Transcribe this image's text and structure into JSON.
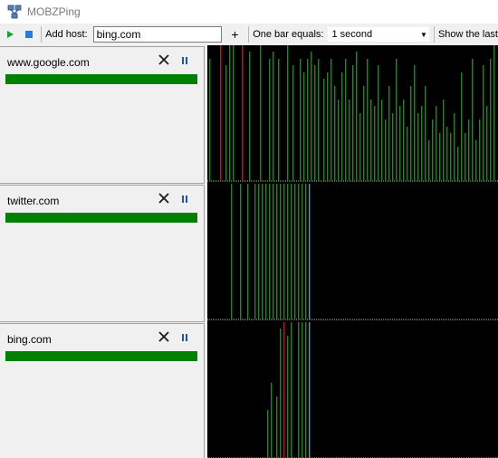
{
  "app": {
    "title": "MOBZPing"
  },
  "toolbar": {
    "add_host_label": "Add host:",
    "host_value": "bing.com",
    "add_button": "+",
    "bar_label": "One bar equals:",
    "bar_value": "1 second",
    "show_last_label": "Show the last"
  },
  "colors": {
    "ok_bar": "#00a000",
    "lost_bar": "#ff0000",
    "marker_bar": "#3fa0d0",
    "status_ok": "#008000",
    "baseline": "#c8c850"
  },
  "hosts": [
    {
      "name": "www.google.com",
      "pings": [
        0,
        1,
        0,
        0,
        0,
        0,
        0,
        2,
        0,
        0,
        1,
        0,
        1,
        0,
        1,
        0,
        0,
        0,
        0,
        2,
        0,
        0,
        0,
        1,
        0,
        0,
        0,
        0,
        0,
        1,
        0,
        0,
        0,
        0,
        1,
        0,
        1,
        0,
        0,
        1,
        0,
        0,
        0,
        0,
        1,
        0,
        0,
        1,
        0,
        0,
        0,
        1,
        0,
        1,
        0,
        1,
        0,
        1,
        0,
        1,
        0,
        1,
        0,
        0,
        1,
        0,
        1,
        0,
        1,
        0,
        1,
        0,
        1,
        0,
        1,
        0,
        1,
        0,
        1,
        0,
        1,
        0,
        1,
        0,
        1,
        0,
        1,
        0,
        1,
        0,
        1,
        0,
        1,
        0,
        1,
        0,
        1,
        0,
        1,
        0,
        1,
        0,
        1,
        0,
        1,
        0,
        1,
        0,
        1,
        0,
        1,
        0,
        1,
        0,
        1,
        0,
        1,
        0,
        1,
        0,
        1,
        0,
        1,
        0,
        1,
        0,
        1,
        0,
        1,
        0,
        1,
        0,
        1,
        0,
        1,
        0,
        1,
        0,
        1,
        0,
        1,
        0,
        1,
        0,
        1,
        0,
        1,
        0,
        1,
        0,
        1,
        0,
        1,
        0,
        1,
        0,
        1,
        0,
        1,
        0
      ],
      "levels": [
        0,
        0.9,
        0,
        0,
        0,
        0,
        0,
        1,
        0,
        0,
        0.85,
        0,
        1,
        0,
        1,
        0,
        0,
        0,
        0,
        1,
        0,
        0,
        0,
        0.95,
        0,
        0,
        0,
        0,
        0,
        1,
        0,
        0,
        0,
        0,
        0.9,
        0,
        0.95,
        0,
        0,
        0.9,
        0,
        0,
        0,
        0,
        1,
        0,
        0,
        0.85,
        0,
        0,
        0,
        0.9,
        0,
        0.8,
        0,
        0.9,
        0,
        0.95,
        0,
        0.85,
        0,
        0.9,
        0,
        0,
        0.75,
        0,
        0.8,
        0,
        0.9,
        0,
        0.7,
        0,
        0.6,
        0,
        0.8,
        0,
        0.9,
        0,
        0.6,
        0,
        0.85,
        0,
        0.95,
        0,
        0.5,
        0,
        0.7,
        0,
        0.9,
        0,
        0.6,
        0,
        0.55,
        0,
        0.85,
        0,
        0.6,
        0,
        0.45,
        0,
        0.7,
        0,
        0.5,
        0,
        0.9,
        0,
        0.55,
        0,
        0.6,
        0,
        0.4,
        0,
        0.7,
        0,
        0.85,
        0,
        0.5,
        0,
        0.55,
        0,
        0.7,
        0,
        0.3,
        0,
        0.45,
        0,
        0.55,
        0,
        0.35,
        0,
        0.6,
        0,
        0.4,
        0,
        0.35,
        0,
        0.5,
        0,
        0.25,
        0,
        0.8,
        0,
        0.35,
        0,
        0.45,
        0,
        0.9,
        0,
        0.3,
        0,
        0.45,
        0,
        0.85,
        0,
        0.55,
        0,
        0.9,
        0
      ]
    },
    {
      "name": "twitter.com",
      "pings": [
        0,
        0,
        0,
        0,
        0,
        0,
        0,
        0,
        0,
        0,
        0,
        0,
        0,
        1,
        0,
        0,
        0,
        0,
        1,
        0,
        0,
        0,
        1,
        0,
        0,
        0,
        1,
        0,
        1,
        0,
        1,
        0,
        1,
        0,
        1,
        0,
        1,
        0,
        1,
        0,
        1,
        0,
        1,
        0,
        1,
        0,
        1,
        0,
        1,
        0,
        1,
        0,
        1,
        0,
        1,
        0,
        3
      ],
      "levels": [
        0,
        0,
        0,
        0,
        0,
        0,
        0,
        0,
        0,
        0,
        0,
        0,
        0,
        1,
        0,
        0,
        0,
        0,
        1,
        0,
        0,
        0,
        1,
        0,
        0,
        0,
        1,
        0,
        1,
        0,
        1,
        0,
        1,
        0,
        1,
        0,
        1,
        0,
        1,
        0,
        1,
        0,
        1,
        0,
        1,
        0,
        1,
        0,
        1,
        0,
        1,
        0,
        1,
        0,
        1,
        0,
        1
      ]
    },
    {
      "name": "bing.com",
      "pings": [
        0,
        0,
        0,
        0,
        0,
        0,
        0,
        0,
        0,
        0,
        0,
        0,
        0,
        0,
        0,
        0,
        0,
        0,
        0,
        0,
        0,
        0,
        0,
        0,
        0,
        0,
        0,
        0,
        0,
        0,
        0,
        0,
        0,
        1,
        0,
        1,
        0,
        0,
        1,
        0,
        1,
        0,
        2,
        0,
        1,
        0,
        1,
        0,
        0,
        0,
        1,
        0,
        1,
        0,
        1,
        0,
        3
      ],
      "levels": [
        0,
        0,
        0,
        0,
        0,
        0,
        0,
        0,
        0,
        0,
        0,
        0,
        0,
        0,
        0,
        0,
        0,
        0,
        0,
        0,
        0,
        0,
        0,
        0,
        0,
        0,
        0,
        0,
        0,
        0,
        0,
        0,
        0,
        0.35,
        0,
        0.55,
        0,
        0,
        0.45,
        0,
        0.95,
        0,
        1,
        0,
        0.9,
        0,
        1,
        0,
        0,
        0,
        1,
        0,
        1,
        0,
        1,
        0,
        1
      ]
    }
  ]
}
